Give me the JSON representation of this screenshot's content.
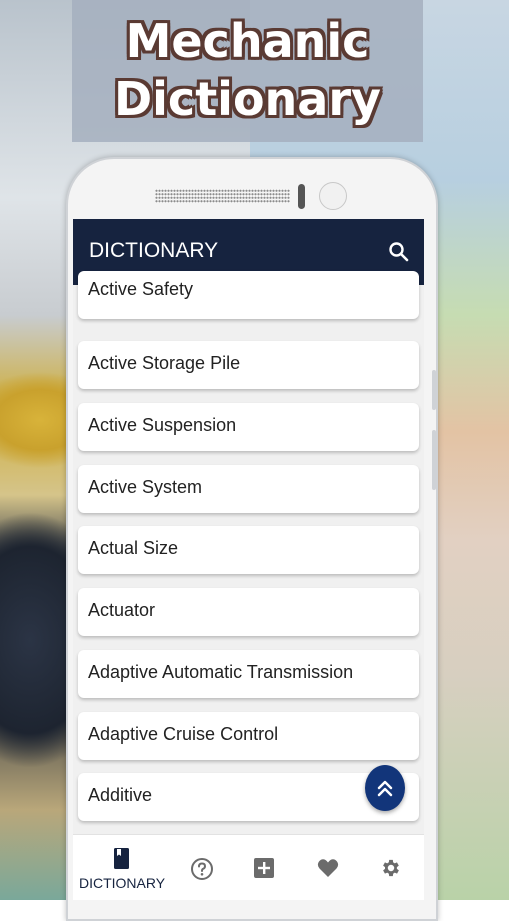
{
  "promo": {
    "title_line1": "Mechanic",
    "title_line2": "Dictionary"
  },
  "appbar": {
    "title": "DICTIONARY",
    "search_icon": "search-icon"
  },
  "list": {
    "items": [
      {
        "label": "Active Safety"
      },
      {
        "label": "Active Storage Pile"
      },
      {
        "label": "Active Suspension"
      },
      {
        "label": "Active System"
      },
      {
        "label": "Actual Size"
      },
      {
        "label": "Actuator"
      },
      {
        "label": "Adaptive Automatic Transmission"
      },
      {
        "label": "Adaptive Cruise Control"
      },
      {
        "label": "Additive"
      }
    ]
  },
  "fab": {
    "icon": "double-chevron-up-icon"
  },
  "bottom_nav": {
    "items": [
      {
        "icon": "book-icon",
        "label": "DICTIONARY",
        "active": true
      },
      {
        "icon": "help-circle-icon",
        "label": ""
      },
      {
        "icon": "add-box-icon",
        "label": ""
      },
      {
        "icon": "heart-icon",
        "label": ""
      },
      {
        "icon": "gear-icon",
        "label": ""
      }
    ]
  },
  "colors": {
    "appbar": "#16233f",
    "fab": "#12357a",
    "nav_active": "#16233f",
    "nav_inactive": "#6b6b6b",
    "title_outline": "#5a3a33"
  }
}
